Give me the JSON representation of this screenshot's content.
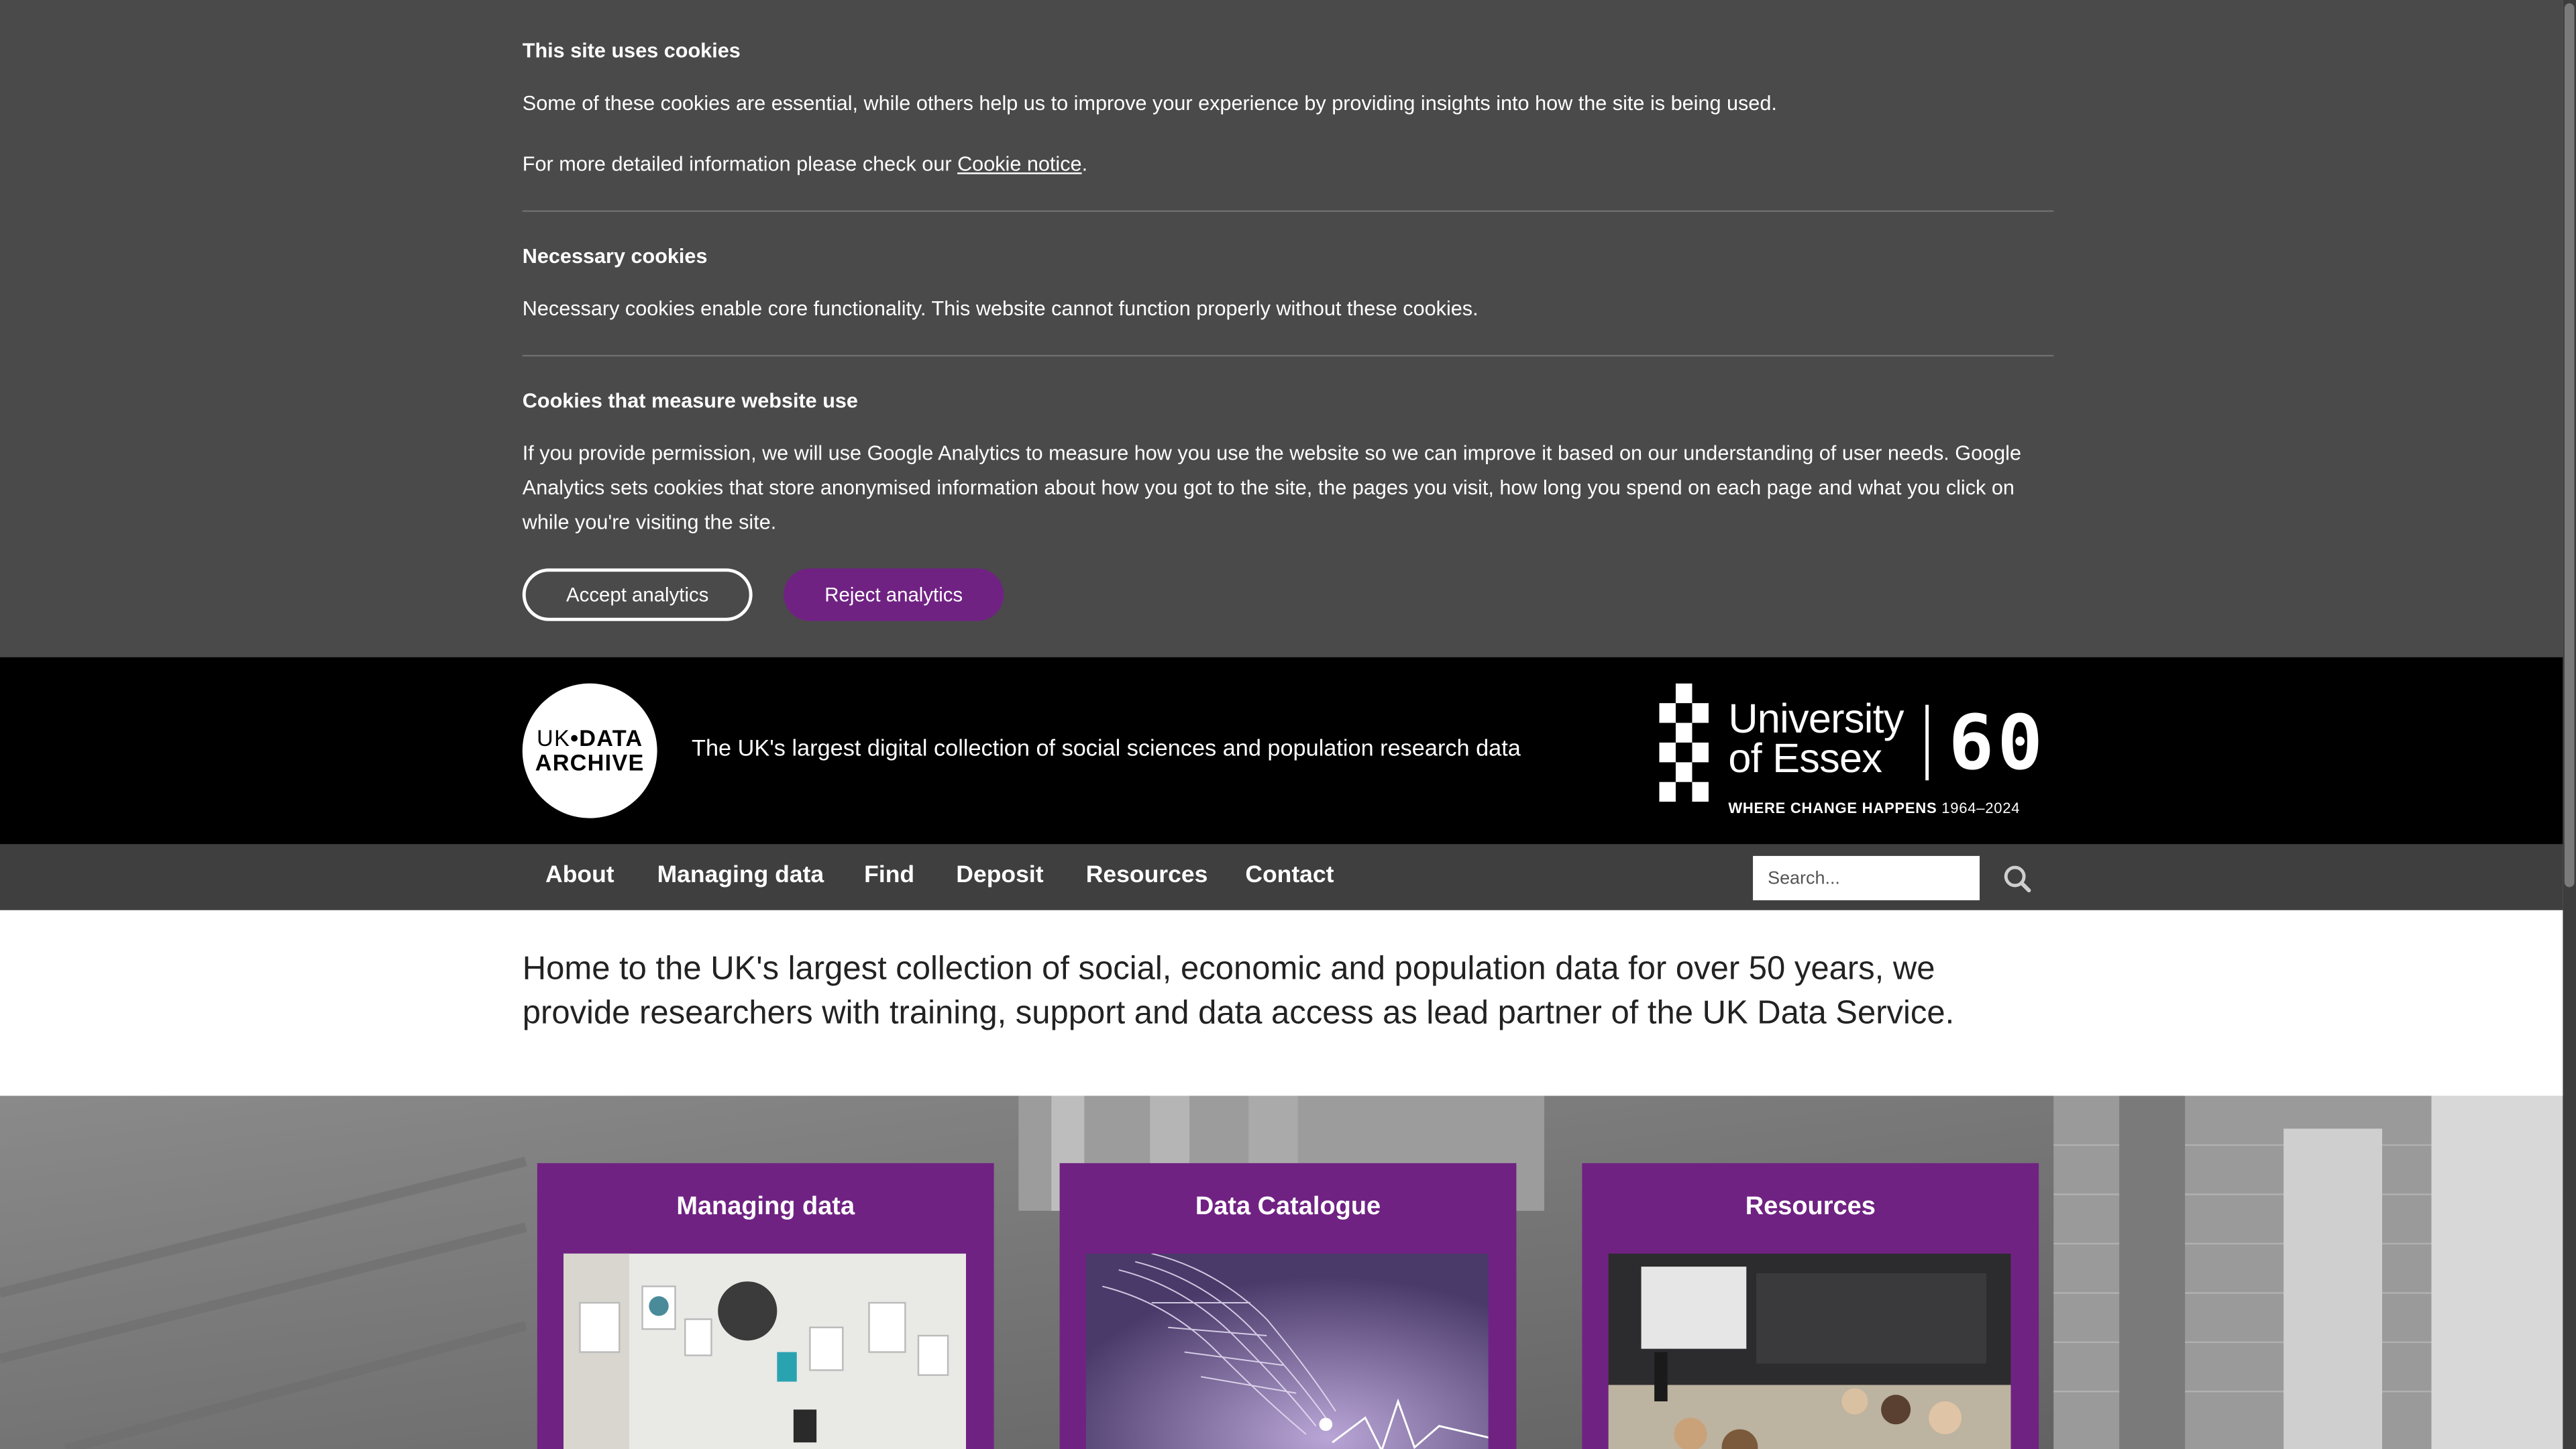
{
  "cookie_banner": {
    "title": "This site uses cookies",
    "intro": "Some of these cookies are essential, while others help us to improve your experience by providing insights into how the site is being used.",
    "more_info_prefix": "For more detailed information please check our ",
    "more_info_link": "Cookie notice",
    "more_info_suffix": ".",
    "necessary_title": "Necessary cookies",
    "necessary_text": "Necessary cookies enable core functionality. This website cannot function properly without these cookies.",
    "analytics_title": "Cookies that measure website use",
    "analytics_text": "If you provide permission, we will use Google Analytics to measure how you use the website so we can improve it based on our understanding of user needs. Google Analytics sets cookies that store anonymised information about how you got to the site, the pages you visit, how long you spend on each page and what you click on while you're visiting the site.",
    "accept_label": "Accept analytics",
    "reject_label": "Reject analytics"
  },
  "header": {
    "logo_line1_a": "UK",
    "logo_dot": "•",
    "logo_line1_b": "DATA",
    "logo_line2": "ARCHIVE",
    "tagline": "The UK's largest digital collection of social sciences and population research data",
    "essex_line1": "University",
    "essex_line2": "of Essex",
    "essex_60": "60",
    "essex_motto": "WHERE CHANGE HAPPENS",
    "essex_years": "1964–2024"
  },
  "nav": {
    "items": [
      "About",
      "Managing data",
      "Find",
      "Deposit",
      "Resources",
      "Contact"
    ],
    "search_placeholder": "Search..."
  },
  "intro": "Home to the UK's largest collection of social, economic and population data for over 50 years, we provide researchers with training, support and data access as lead partner of the UK Data Service.",
  "cards": [
    {
      "title": "Managing data"
    },
    {
      "title": "Data Catalogue"
    },
    {
      "title": "Resources"
    }
  ],
  "colors": {
    "brand_purple": "#702283",
    "banner_bg": "#4a4a4a",
    "nav_bg": "#3f3f3f"
  }
}
